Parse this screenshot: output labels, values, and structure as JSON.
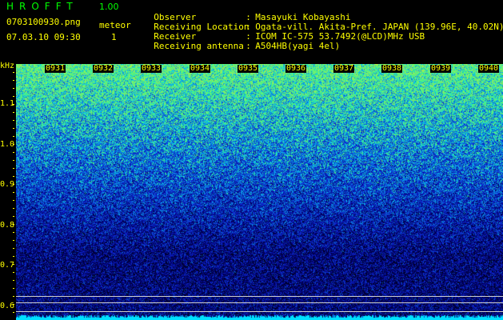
{
  "header": {
    "app_title": "HROFFT",
    "app_version": "1.00",
    "file_name": "0703100930.png",
    "datetime": "07.03.10 09:30",
    "meteor_label": "meteor",
    "meteor_count": "1"
  },
  "info": {
    "observer_key": "Observer",
    "observer_value": "Masayuki Kobayashi",
    "location_key": "Receiving Location",
    "location_value": "Ogata-vill. Akita-Pref. JAPAN (139.96E, 40.02N)",
    "receiver_key": "Receiver",
    "receiver_value": "ICOM IC-575 53.7492(@LCD)MHz USB",
    "antenna_key": "Receiving antenna",
    "antenna_value": "A504HB(yagi 4el)",
    "separator": ":"
  },
  "spectrogram": {
    "y_unit": "kHz",
    "time_ticks": [
      "0931",
      "0932",
      "0933",
      "0934",
      "0935",
      "0936",
      "0937",
      "0938",
      "0939",
      "0940"
    ],
    "freq_ticks": [
      "1.1",
      "1.0",
      "0.9",
      "0.8",
      "0.7",
      "0.6"
    ],
    "colors": {
      "background": "#000000",
      "label": "#ffff00",
      "title": "#00ff00",
      "noise_low": "#0a1a8a",
      "noise_high": "#33ff99",
      "baseline": "#00e0ff"
    }
  }
}
